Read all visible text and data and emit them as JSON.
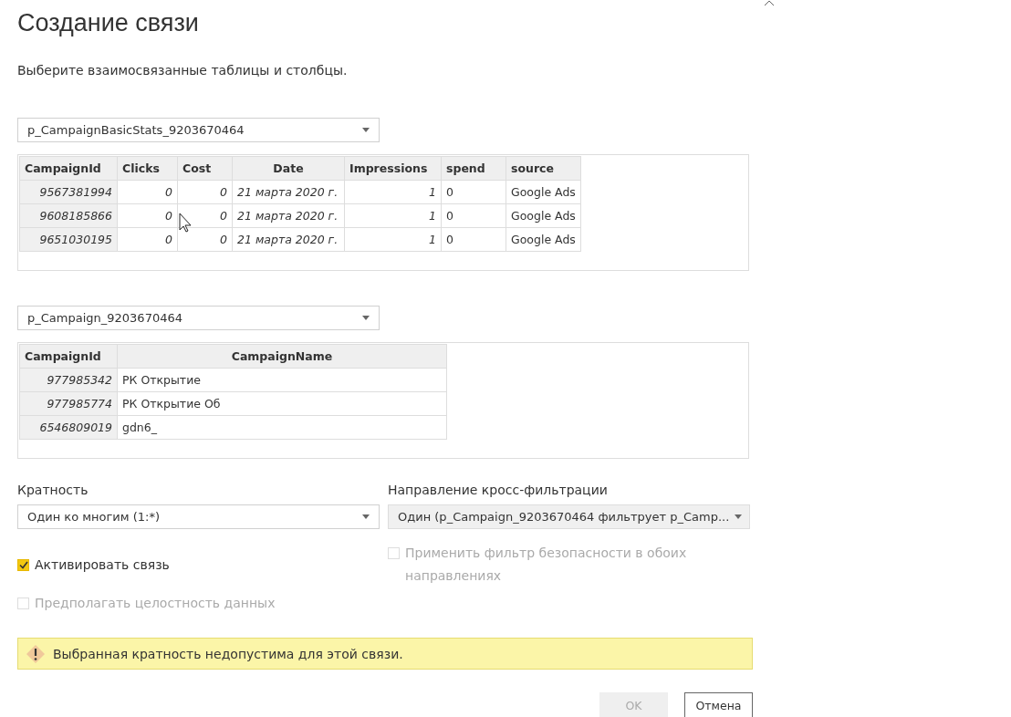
{
  "dialog": {
    "title": "Создание связи",
    "subtitle": "Выберите взаимосвязанные таблицы и столбцы."
  },
  "tables": [
    {
      "selector": {
        "value": "p_CampaignBasicStats_9203670464"
      },
      "columns": [
        {
          "label": "CampaignId",
          "kind": "key"
        },
        {
          "label": "Clicks",
          "kind": "number"
        },
        {
          "label": "Cost",
          "kind": "number"
        },
        {
          "label": "Date",
          "kind": "date"
        },
        {
          "label": "Impressions",
          "kind": "number"
        },
        {
          "label": "spend",
          "kind": "text"
        },
        {
          "label": "source",
          "kind": "text"
        }
      ],
      "rows": [
        [
          "9567381994",
          "0",
          "0",
          "21 марта 2020 г.",
          "1",
          "0",
          "Google Ads"
        ],
        [
          "9608185866",
          "0",
          "0",
          "21 марта 2020 г.",
          "1",
          "0",
          "Google Ads"
        ],
        [
          "9651030195",
          "0",
          "0",
          "21 марта 2020 г.",
          "1",
          "0",
          "Google Ads"
        ]
      ]
    },
    {
      "selector": {
        "value": "p_Campaign_9203670464"
      },
      "columns": [
        {
          "label": "CampaignId",
          "kind": "key"
        },
        {
          "label": "CampaignName",
          "kind": "text"
        }
      ],
      "rows": [
        [
          "977985342",
          "РК Открытие"
        ],
        [
          "977985774",
          "РК Открытие Об"
        ],
        [
          "6546809019",
          "gdn6_"
        ]
      ]
    }
  ],
  "cardinality": {
    "label": "Кратность",
    "value": "Один ко многим (1:*)",
    "disabled": false
  },
  "cross_filter": {
    "label": "Направление кросс-фильтрации",
    "value": "Один (p_Campaign_9203670464 фильтрует p_Camp...",
    "disabled": true
  },
  "checkboxes": [
    {
      "label": "Активировать связь",
      "checked": true,
      "disabled": false
    },
    {
      "label": "Предполагать целостность данных",
      "checked": false,
      "disabled": true
    }
  ],
  "security_checkbox": {
    "label": "Применить фильтр безопасности в обоих направлениях",
    "checked": false,
    "disabled": true
  },
  "warning": "Выбранная кратность недопустима для этой связи.",
  "buttons": [
    {
      "label": "OK",
      "disabled": true
    },
    {
      "label": "Отмена",
      "disabled": false
    }
  ]
}
